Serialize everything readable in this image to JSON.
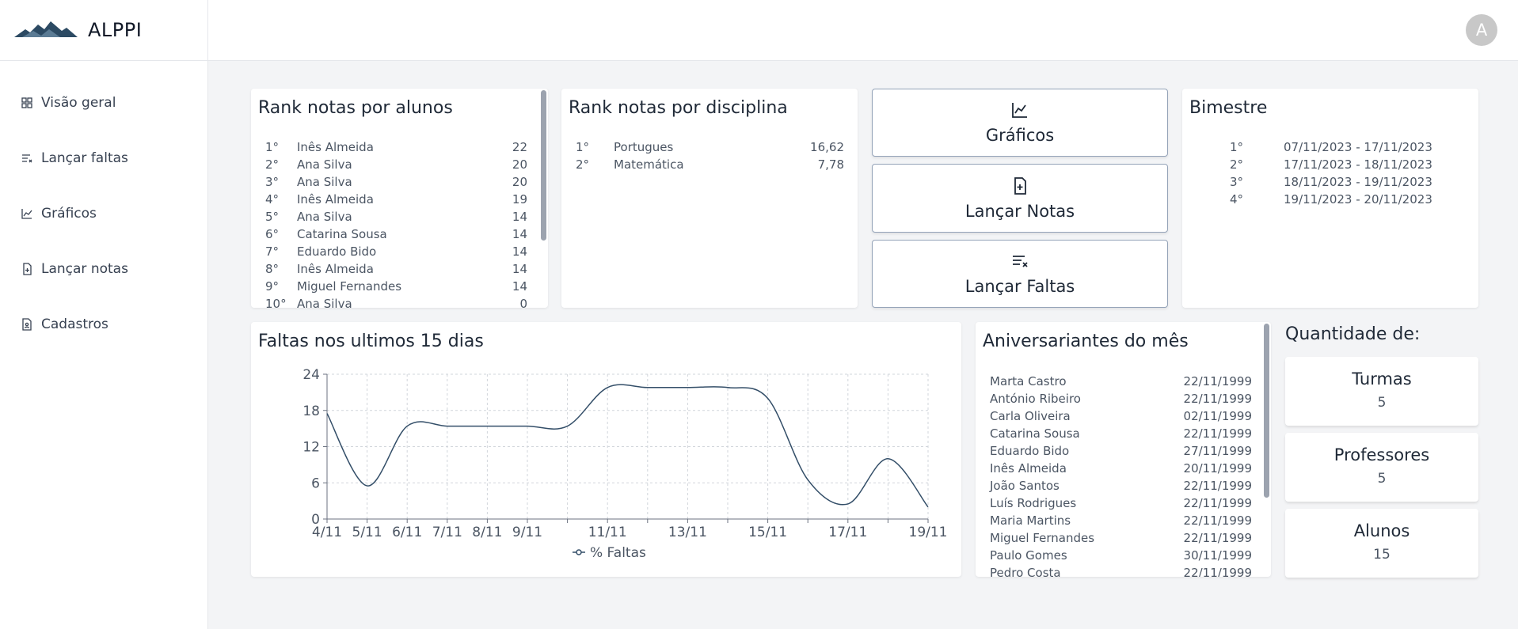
{
  "brand": {
    "name": "ALPPI",
    "logo_icon": "mountain-logo-icon"
  },
  "sidebar": {
    "items": [
      {
        "label": "Visão geral",
        "icon": "grid-icon"
      },
      {
        "label": "Lançar faltas",
        "icon": "list-x-icon"
      },
      {
        "label": "Gráficos",
        "icon": "chart-icon"
      },
      {
        "label": "Lançar notas",
        "icon": "file-plus-icon"
      },
      {
        "label": "Cadastros",
        "icon": "file-user-icon"
      }
    ]
  },
  "topbar": {
    "avatar_letter": "A"
  },
  "rank_alunos": {
    "title": "Rank notas por alunos",
    "rows": [
      {
        "pos": "1°",
        "name": "Inês Almeida",
        "value": "22"
      },
      {
        "pos": "2°",
        "name": "Ana Silva",
        "value": "20"
      },
      {
        "pos": "3°",
        "name": "Ana Silva",
        "value": "20"
      },
      {
        "pos": "4°",
        "name": "Inês Almeida",
        "value": "19"
      },
      {
        "pos": "5°",
        "name": "Ana Silva",
        "value": "14"
      },
      {
        "pos": "6°",
        "name": "Catarina Sousa",
        "value": "14"
      },
      {
        "pos": "7°",
        "name": "Eduardo Bido",
        "value": "14"
      },
      {
        "pos": "8°",
        "name": "Inês Almeida",
        "value": "14"
      },
      {
        "pos": "9°",
        "name": "Miguel Fernandes",
        "value": "14"
      },
      {
        "pos": "10°",
        "name": "Ana Silva",
        "value": "0"
      }
    ]
  },
  "rank_disciplina": {
    "title": "Rank notas por disciplina",
    "rows": [
      {
        "pos": "1°",
        "name": "Portugues",
        "value": "16,62"
      },
      {
        "pos": "2°",
        "name": "Matemática",
        "value": "7,78"
      }
    ]
  },
  "actions": {
    "graficos": {
      "label": "Gráficos",
      "icon": "chart-icon"
    },
    "lancar_notas": {
      "label": "Lançar Notas",
      "icon": "file-plus-icon"
    },
    "lancar_faltas": {
      "label": "Lançar Faltas",
      "icon": "list-x-icon"
    }
  },
  "bimestre": {
    "title": "Bimestre",
    "rows": [
      {
        "pos": "1°",
        "range": "07/11/2023 - 17/11/2023"
      },
      {
        "pos": "2°",
        "range": "17/11/2023 - 18/11/2023"
      },
      {
        "pos": "3°",
        "range": "18/11/2023 - 19/11/2023"
      },
      {
        "pos": "4°",
        "range": "19/11/2023 - 20/11/2023"
      }
    ]
  },
  "faltas": {
    "title": "Faltas nos ultimos 15 dias"
  },
  "chart_data": {
    "type": "line",
    "title": "Faltas nos ultimos 15 dias",
    "x": [
      "4/11",
      "5/11",
      "6/11",
      "7/11",
      "8/11",
      "9/11",
      "10/11",
      "11/11",
      "12/11",
      "13/11",
      "14/11",
      "15/11",
      "16/11",
      "17/11",
      "18/11",
      "19/11"
    ],
    "x_tick_labels": [
      "4/11",
      "5/11",
      "6/11",
      "7/11",
      "8/11",
      "9/11",
      "11/11",
      "13/11",
      "15/11",
      "17/11",
      "19/11"
    ],
    "series": [
      {
        "name": "% Faltas",
        "values": [
          17.5,
          5.5,
          15.4,
          15.4,
          15.4,
          15.4,
          15.4,
          21.8,
          21.8,
          21.8,
          21.8,
          20,
          6.5,
          2.5,
          10,
          2
        ]
      }
    ],
    "y_ticks": [
      0,
      6,
      12,
      18,
      24
    ],
    "ylim": [
      0,
      24
    ],
    "grid": true,
    "legend": "bottom",
    "line_color": "#334e68"
  },
  "aniversariantes": {
    "title": "Aniversariantes do mês",
    "rows": [
      {
        "name": "Marta Castro",
        "date": "22/11/1999"
      },
      {
        "name": "António Ribeiro",
        "date": "22/11/1999"
      },
      {
        "name": "Carla Oliveira",
        "date": "02/11/1999"
      },
      {
        "name": "Catarina Sousa",
        "date": "22/11/1999"
      },
      {
        "name": "Eduardo Bido",
        "date": "27/11/1999"
      },
      {
        "name": "Inês Almeida",
        "date": "20/11/1999"
      },
      {
        "name": "João Santos",
        "date": "22/11/1999"
      },
      {
        "name": "Luís Rodrigues",
        "date": "22/11/1999"
      },
      {
        "name": "Maria Martins",
        "date": "22/11/1999"
      },
      {
        "name": "Miguel Fernandes",
        "date": "22/11/1999"
      },
      {
        "name": "Paulo Gomes",
        "date": "30/11/1999"
      },
      {
        "name": "Pedro Costa",
        "date": "22/11/1999"
      }
    ]
  },
  "quantidade": {
    "title": "Quantidade de:",
    "items": [
      {
        "label": "Turmas",
        "value": "5"
      },
      {
        "label": "Professores",
        "value": "5"
      },
      {
        "label": "Alunos",
        "value": "15"
      }
    ]
  }
}
